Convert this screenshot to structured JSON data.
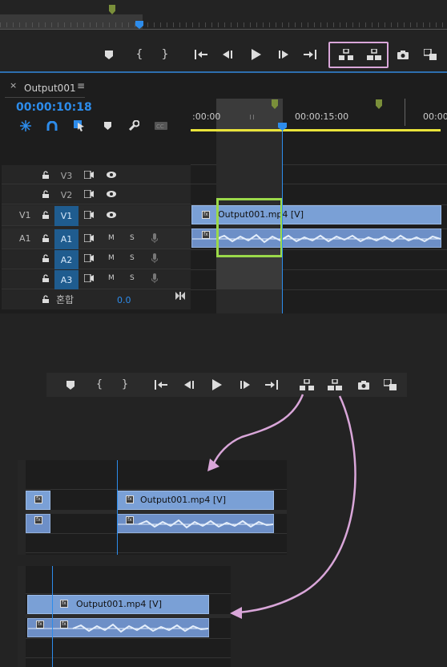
{
  "top_bar": {
    "transport_icons": [
      "marker-icon",
      "mark-in-icon",
      "mark-out-icon",
      "go-to-in-icon",
      "step-back-icon",
      "play-icon",
      "step-forward-icon",
      "go-to-out-icon",
      "lift-icon",
      "extract-icon",
      "export-frame-icon",
      "button-editor-icon"
    ]
  },
  "timeline": {
    "close_glyph": "×",
    "tab_title": "Output001",
    "menu_glyph": "≡",
    "timecode": "00:00:10:18",
    "ruler": {
      "left_label": ":00:00",
      "mid_label": "00:00:15:00",
      "right_label": "00:00"
    },
    "video_tracks": [
      {
        "source": "",
        "name": "V3"
      },
      {
        "source": "",
        "name": "V2"
      },
      {
        "source": "V1",
        "name": "V1"
      }
    ],
    "audio_tracks": [
      {
        "source": "A1",
        "name": "A1",
        "m": "M",
        "s": "S"
      },
      {
        "source": "",
        "name": "A2",
        "m": "M",
        "s": "S"
      },
      {
        "source": "",
        "name": "A3",
        "m": "M",
        "s": "S"
      }
    ],
    "mix": {
      "label": "혼합",
      "value": "0.0"
    },
    "clip_label": "Output001.mp4 [V]"
  },
  "examples": {
    "lift_clip_label": "Output001.mp4 [V]",
    "extract_clip_label": "Output001.mp4 [V]"
  },
  "colors": {
    "accent": "#2d8ceb",
    "highlight_pink": "#d9a6d9",
    "highlight_green": "#9bd94a",
    "clip_blue": "#7aa0d6",
    "work_area_yellow": "#e9e33a"
  }
}
